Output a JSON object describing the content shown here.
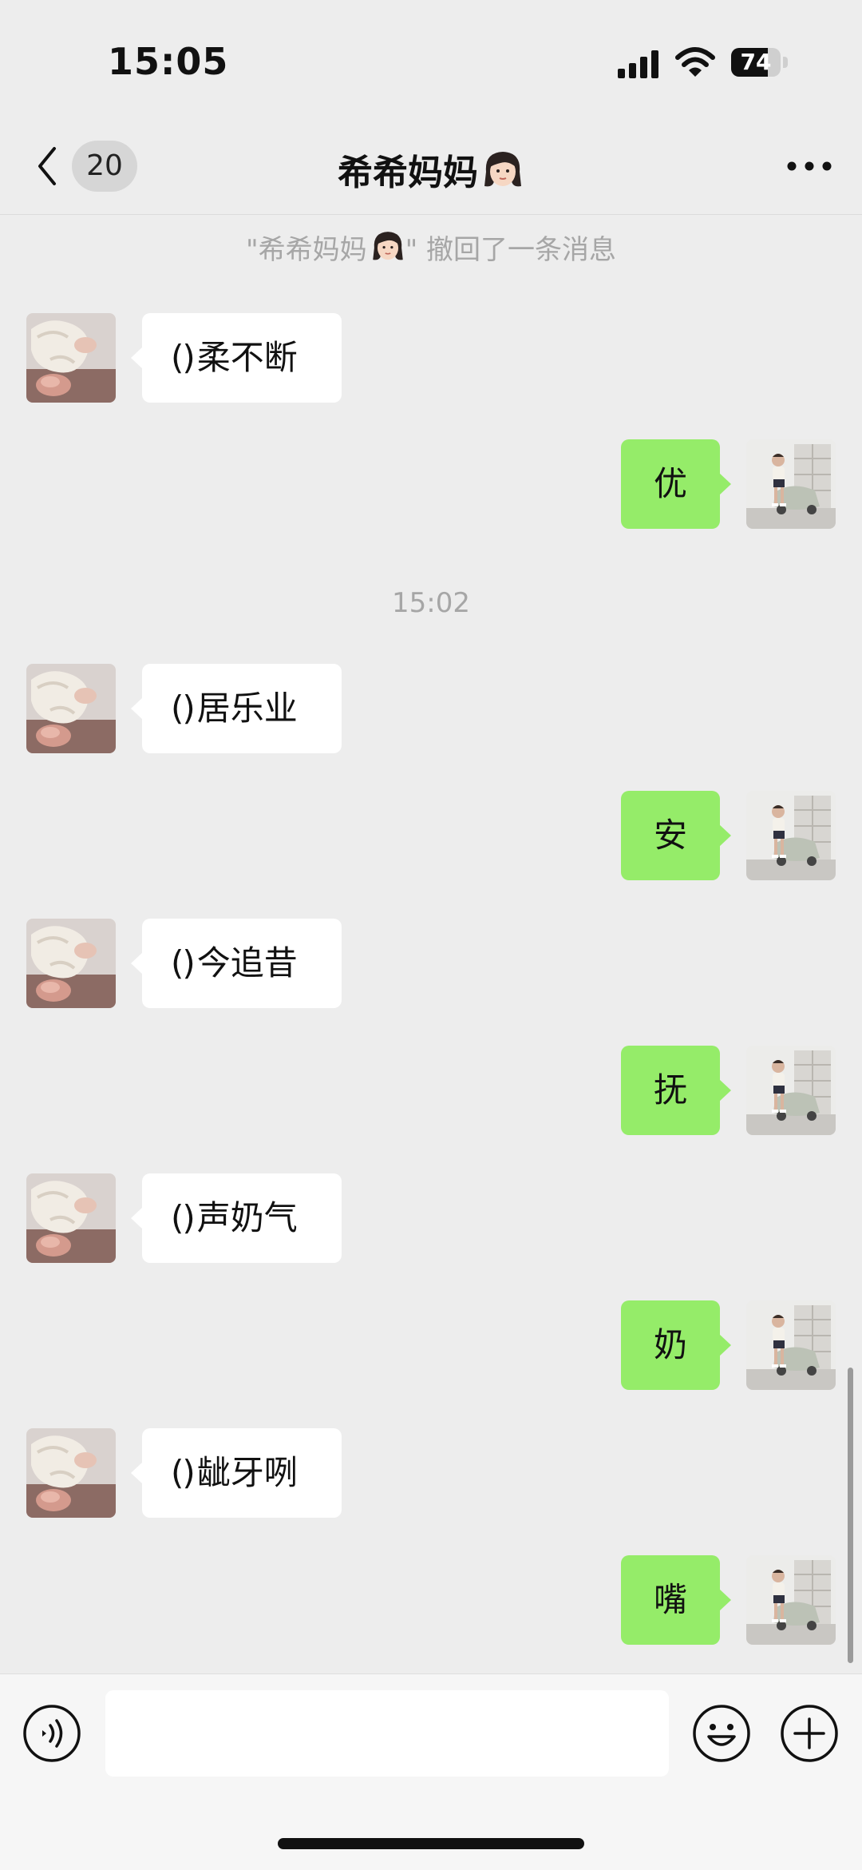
{
  "status_bar": {
    "time": "15:05",
    "battery_percent": 74
  },
  "nav": {
    "unread_count": "20",
    "title": "希希妈妈"
  },
  "system_messages": {
    "recall_prefix": "\"希希妈妈",
    "recall_suffix": "\" 撤回了一条消息",
    "timestamp": "15:02"
  },
  "messages": [
    {
      "side": "left",
      "paren": "()",
      "text": "柔不断"
    },
    {
      "side": "right",
      "text": "优"
    },
    {
      "side": "left",
      "paren": "()",
      "text": "居乐业"
    },
    {
      "side": "right",
      "text": "安"
    },
    {
      "side": "left",
      "paren": "()",
      "text": "今追昔"
    },
    {
      "side": "right",
      "text": "抚"
    },
    {
      "side": "left",
      "paren": "()",
      "text": "声奶气"
    },
    {
      "side": "right",
      "text": "奶"
    },
    {
      "side": "left",
      "paren": "()",
      "text": "龇牙咧"
    },
    {
      "side": "right",
      "text": "嘴"
    }
  ],
  "input": {
    "placeholder": ""
  },
  "colors": {
    "background": "#ededed",
    "sent_bubble": "#95ec69",
    "received_bubble": "#ffffff",
    "system_text": "#a6a6a6"
  },
  "icons": {
    "back": "chevron-left-icon",
    "more": "more-dots-icon",
    "voice": "voice-icon",
    "emoji": "emoji-icon",
    "plus": "plus-icon",
    "title_emoji": "woman-face-emoji"
  }
}
